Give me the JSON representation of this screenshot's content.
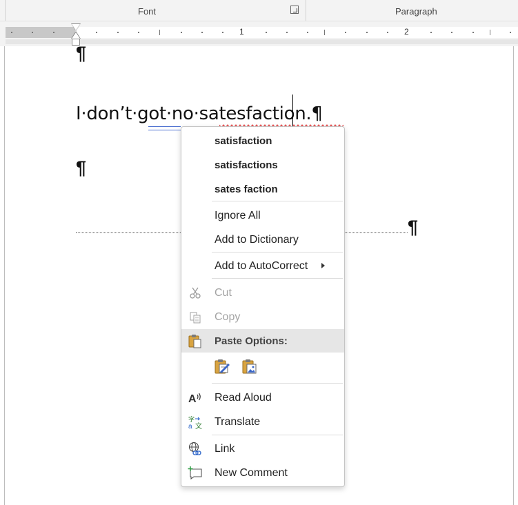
{
  "ribbon": {
    "font_label": "Font",
    "paragraph_label": "Paragraph"
  },
  "ruler": {
    "numbers": [
      "1",
      "2"
    ]
  },
  "document": {
    "line_text": "I·don’t·got·no·satesfaction.¶",
    "pilcrow": "¶"
  },
  "context_menu": {
    "suggestions": [
      "satisfaction",
      "satisfactions",
      "sates faction"
    ],
    "ignore_all": "Ignore All",
    "add_to_dictionary": "Add to Dictionary",
    "add_to_autocorrect": "Add to AutoCorrect",
    "cut": "Cut",
    "copy": "Copy",
    "paste_options": "Paste Options:",
    "read_aloud": "Read Aloud",
    "translate": "Translate",
    "link": "Link",
    "new_comment": "New Comment"
  },
  "icons": {
    "dialog_launcher": "dialog-launcher-icon",
    "cut": "scissors-icon",
    "copy": "copy-icon",
    "paste": "clipboard-icon",
    "paste_keep_formatting": "paste-keep-formatting-icon",
    "paste_picture": "paste-picture-icon",
    "read_aloud": "read-aloud-icon",
    "translate": "translate-icon",
    "link": "globe-link-icon",
    "new_comment": "new-comment-icon"
  },
  "colors": {
    "spelling_error": "#e02020",
    "grammar_error": "#4b6fd0",
    "menu_hover": "#e6e6e6"
  }
}
